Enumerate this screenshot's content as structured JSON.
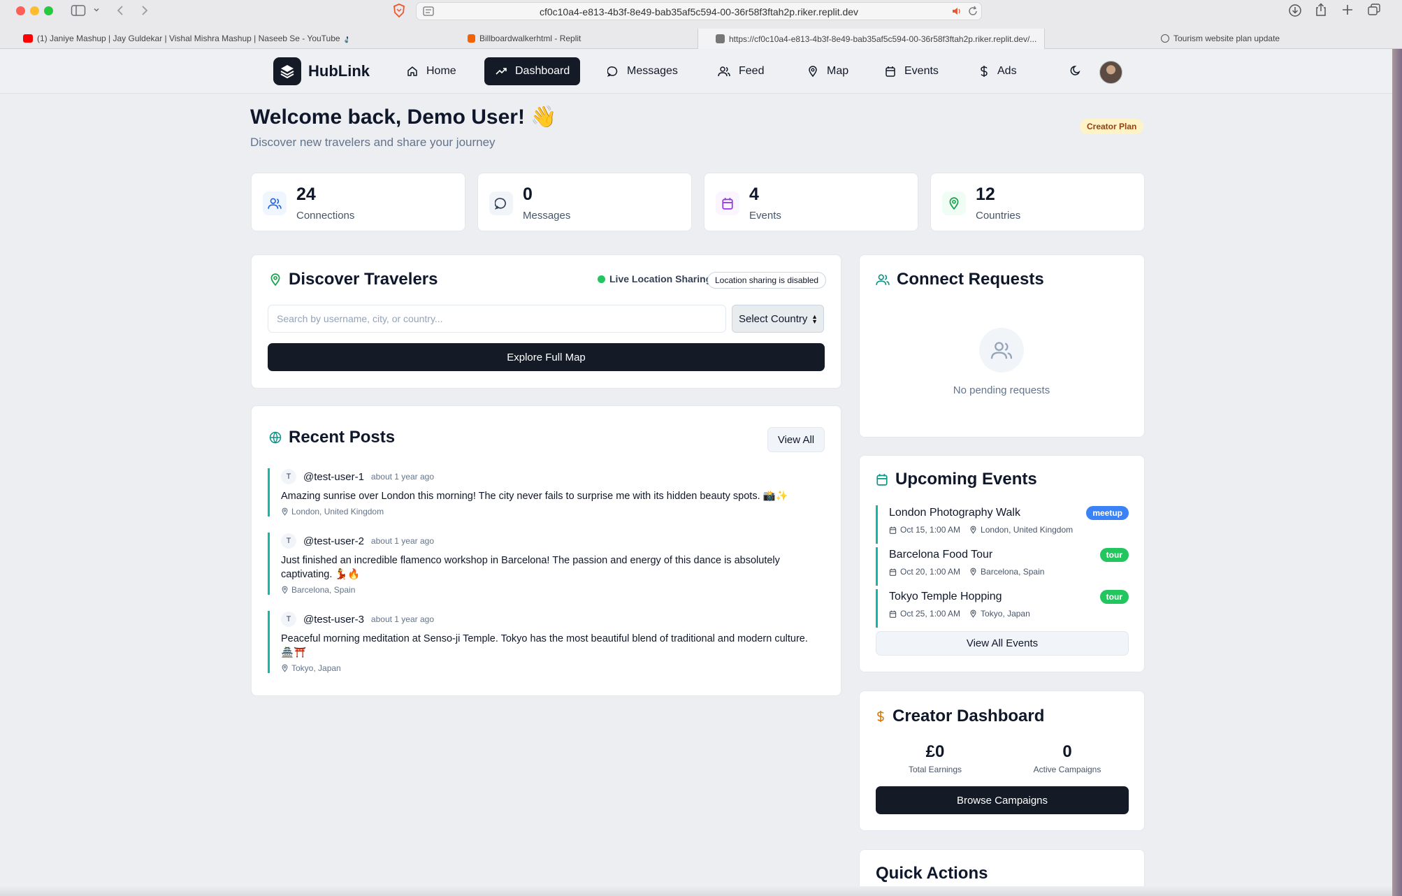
{
  "browser": {
    "url": "cf0c10a4-e813-4b3f-8e49-bab35af5c594-00-36r58f3ftah2p.riker.replit.dev",
    "tabs": [
      {
        "label": "(1) Janiye Mashup | Jay Guldekar | Vishal Mishra Mashup | Naseeb Se - YouTube"
      },
      {
        "label": "Billboardwalkerhtml - Replit"
      },
      {
        "label": "https://cf0c10a4-e813-4b3f-8e49-bab35af5c594-00-36r58f3ftah2p.riker.replit.dev/..."
      },
      {
        "label": "Tourism website plan update"
      }
    ]
  },
  "nav": {
    "brand": "HubLink",
    "items": [
      {
        "label": "Home",
        "icon": "home-icon"
      },
      {
        "label": "Dashboard",
        "icon": "trending-icon"
      },
      {
        "label": "Messages",
        "icon": "message-icon"
      },
      {
        "label": "Feed",
        "icon": "users-icon"
      },
      {
        "label": "Map",
        "icon": "map-pin-icon"
      },
      {
        "label": "Events",
        "icon": "calendar-icon"
      },
      {
        "label": "Ads",
        "icon": "dollar-icon"
      }
    ],
    "active": "Dashboard"
  },
  "header": {
    "title": "Welcome back, Demo User! 👋",
    "subtitle": "Discover new travelers and share your journey",
    "plan_badge": "Creator Plan"
  },
  "stats": [
    {
      "value": "24",
      "label": "Connections",
      "color": "#2563eb"
    },
    {
      "value": "0",
      "label": "Messages",
      "color": "#334155"
    },
    {
      "value": "4",
      "label": "Events",
      "color": "#9333ea"
    },
    {
      "value": "12",
      "label": "Countries",
      "color": "#16a34a"
    }
  ],
  "discover": {
    "title": "Discover Travelers",
    "live_label": "Live Location Sharing",
    "location_badge": "Location sharing is disabled",
    "search_placeholder": "Search by username, city, or country...",
    "country_select": "Select Country",
    "explore_button": "Explore Full Map"
  },
  "recent_posts": {
    "title": "Recent Posts",
    "view_all": "View All",
    "posts": [
      {
        "initial": "T",
        "user": "@test-user-1",
        "time": "about 1 year ago",
        "text": "Amazing sunrise over London this morning! The city never fails to surprise me with its hidden beauty spots. 📸✨",
        "location": "London, United Kingdom"
      },
      {
        "initial": "T",
        "user": "@test-user-2",
        "time": "about 1 year ago",
        "text": "Just finished an incredible flamenco workshop in Barcelona! The passion and energy of this dance is absolutely captivating. 💃🔥",
        "location": "Barcelona, Spain"
      },
      {
        "initial": "T",
        "user": "@test-user-3",
        "time": "about 1 year ago",
        "text": "Peaceful morning meditation at Senso-ji Temple. Tokyo has the most beautiful blend of traditional and modern culture. 🏯⛩️",
        "location": "Tokyo, Japan"
      }
    ]
  },
  "connect_requests": {
    "title": "Connect Requests",
    "empty_text": "No pending requests"
  },
  "upcoming_events": {
    "title": "Upcoming Events",
    "events": [
      {
        "title": "London Photography Walk",
        "date": "Oct 15, 1:00 AM",
        "location": "London, United Kingdom",
        "badge": "meetup",
        "badge_color": "#3b82f6"
      },
      {
        "title": "Barcelona Food Tour",
        "date": "Oct 20, 1:00 AM",
        "location": "Barcelona, Spain",
        "badge": "tour",
        "badge_color": "#22c55e"
      },
      {
        "title": "Tokyo Temple Hopping",
        "date": "Oct 25, 1:00 AM",
        "location": "Tokyo, Japan",
        "badge": "tour",
        "badge_color": "#22c55e"
      }
    ],
    "view_all": "View All Events"
  },
  "creator_dashboard": {
    "title": "Creator Dashboard",
    "earnings_value": "£0",
    "earnings_label": "Total Earnings",
    "campaigns_value": "0",
    "campaigns_label": "Active Campaigns",
    "browse_button": "Browse Campaigns"
  },
  "quick_actions": {
    "title": "Quick Actions"
  },
  "colors": {
    "accent_dark": "#141a26",
    "teal": "#14b8a6",
    "creator_gold": "#d97706"
  }
}
